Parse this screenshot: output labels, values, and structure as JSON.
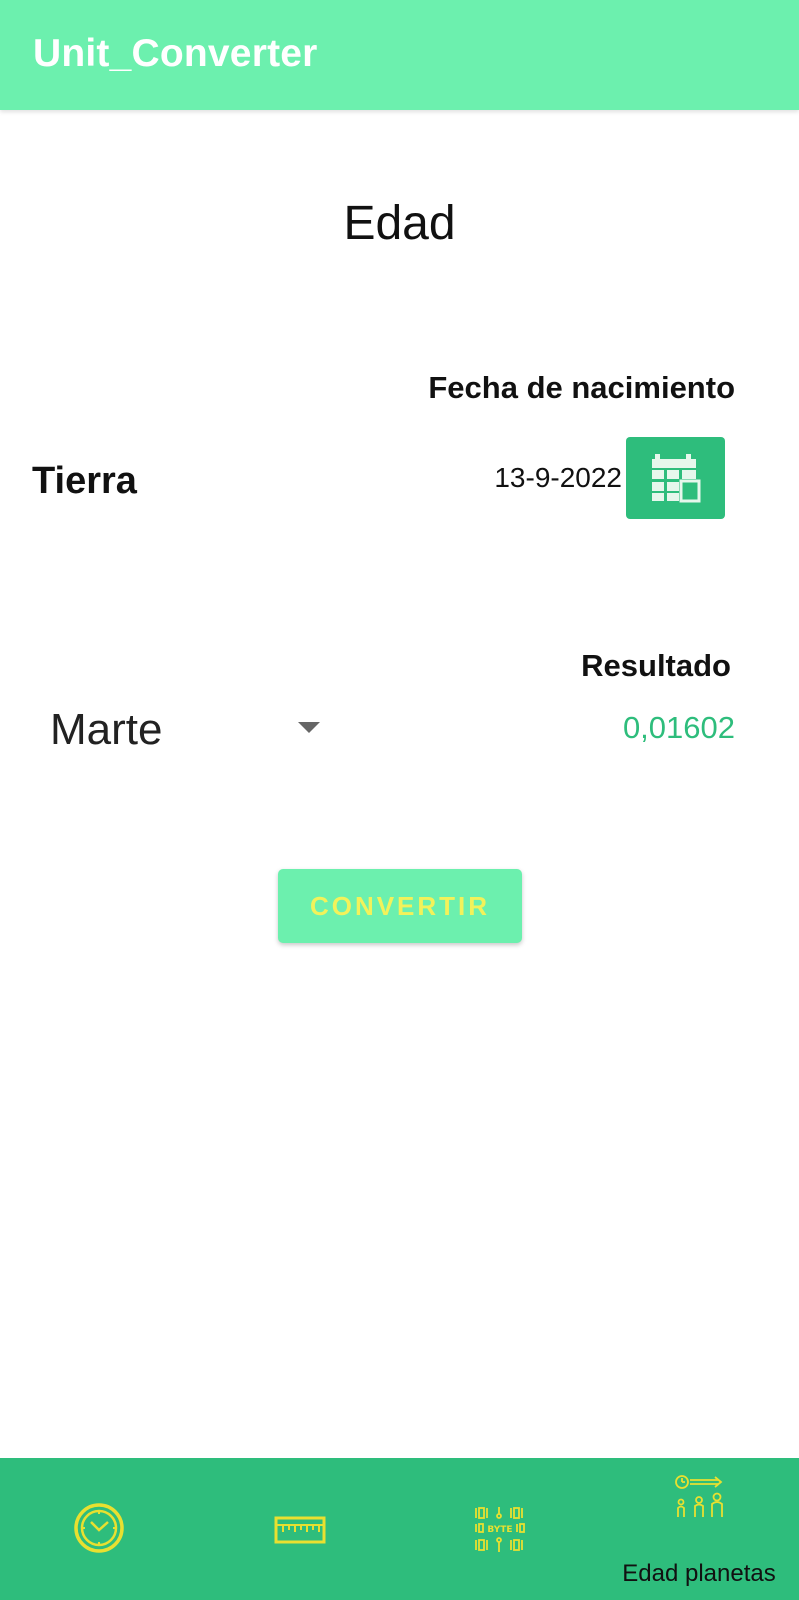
{
  "app_bar": {
    "title": "Unit_Converter"
  },
  "screen": {
    "title": "Edad",
    "birth_label": "Fecha de nacimiento",
    "origin_planet": "Tierra",
    "birth_date": "13-9-2022",
    "result_label": "Resultado",
    "selected_planet": "Marte",
    "result_value": "0,01602",
    "convert_label": "CONVERTIR"
  },
  "bottom_nav": {
    "items": [
      {
        "icon": "clock-icon",
        "label": ""
      },
      {
        "icon": "ruler-icon",
        "label": ""
      },
      {
        "icon": "byte-chip-icon",
        "label": ""
      },
      {
        "icon": "planet-age-icon",
        "label": "Edad planetas",
        "selected": true
      }
    ]
  },
  "colors": {
    "app_bar": "#6cf0ae",
    "accent_green": "#2ebd7c",
    "convert_text": "#f2f25a",
    "icon_yellow": "#e8e030"
  }
}
